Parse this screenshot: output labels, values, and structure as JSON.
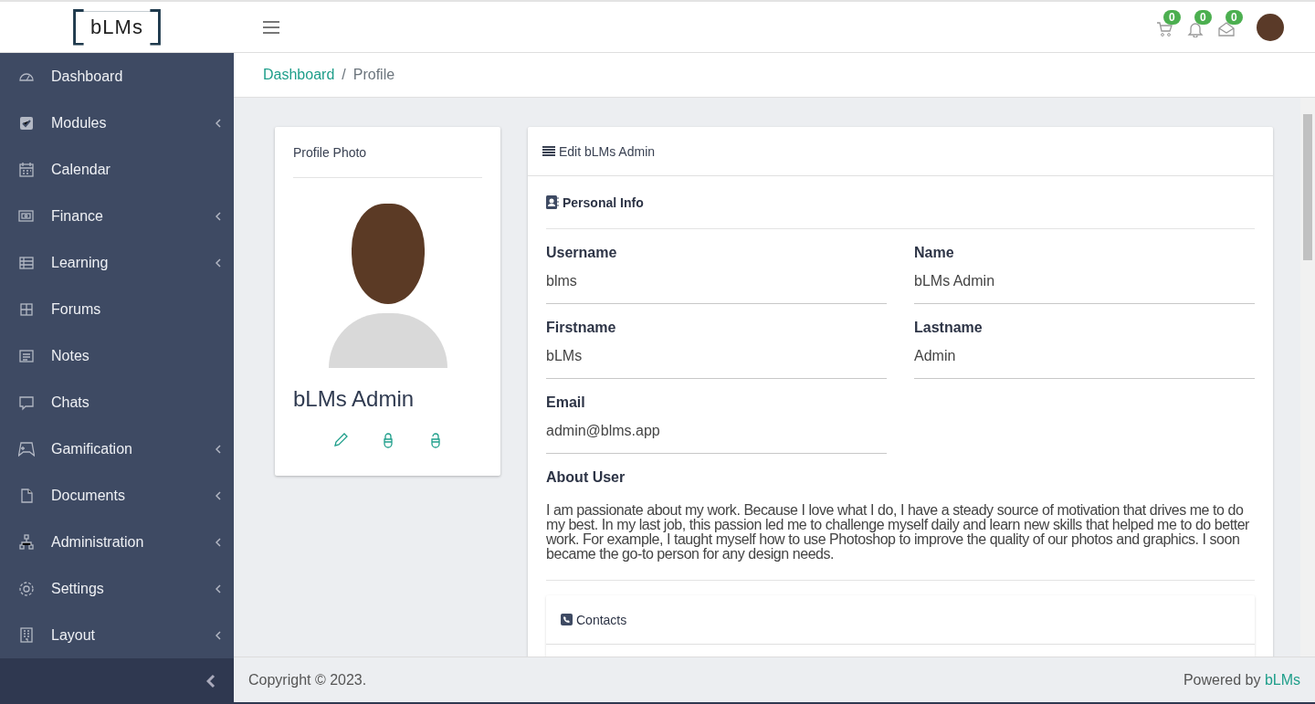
{
  "header": {
    "logo": "bLMs",
    "badges": [
      {
        "kind": "cart",
        "count": "0"
      },
      {
        "kind": "bell",
        "count": "0"
      },
      {
        "kind": "mail",
        "count": "0"
      }
    ]
  },
  "sidebar": {
    "items": [
      {
        "label": "Dashboard",
        "has_submenu": false
      },
      {
        "label": "Modules",
        "has_submenu": true
      },
      {
        "label": "Calendar",
        "has_submenu": false
      },
      {
        "label": "Finance",
        "has_submenu": true
      },
      {
        "label": "Learning",
        "has_submenu": true
      },
      {
        "label": "Forums",
        "has_submenu": false
      },
      {
        "label": "Notes",
        "has_submenu": false
      },
      {
        "label": "Chats",
        "has_submenu": false
      },
      {
        "label": "Gamification",
        "has_submenu": true
      },
      {
        "label": "Documents",
        "has_submenu": true
      },
      {
        "label": "Administration",
        "has_submenu": true
      },
      {
        "label": "Settings",
        "has_submenu": true
      },
      {
        "label": "Layout",
        "has_submenu": true
      }
    ]
  },
  "breadcrumb": [
    "Dashboard",
    "Profile"
  ],
  "breadcrumb_separator": "/",
  "profile_card": {
    "title": "Profile Photo",
    "name": "bLMs Admin"
  },
  "edit_card": {
    "title": "Edit bLMs Admin",
    "section": "Personal Info",
    "fields": [
      {
        "label": "Username",
        "value": "blms"
      },
      {
        "label": "Name",
        "value": "bLMs Admin"
      },
      {
        "label": "Firstname",
        "value": "bLMs"
      },
      {
        "label": "Lastname",
        "value": "Admin"
      },
      {
        "label": "Email",
        "value": "admin@blms.app"
      }
    ],
    "about_label": "About User",
    "about": "I am passionate about my work. Because I love what I do, I have a steady source of motivation that drives me to do my best. In my last job, this passion led me to challenge myself daily and learn new skills that helped me to do better work. For example, I taught myself how to use Photoshop to improve the quality of our photos and graphics. I soon became the go-to person for any design needs.",
    "contacts_title": "Contacts"
  },
  "footer": {
    "copyright": "Copyright © 2023.",
    "powered_prefix": "Powered by",
    "powered_link": "bLMs"
  }
}
